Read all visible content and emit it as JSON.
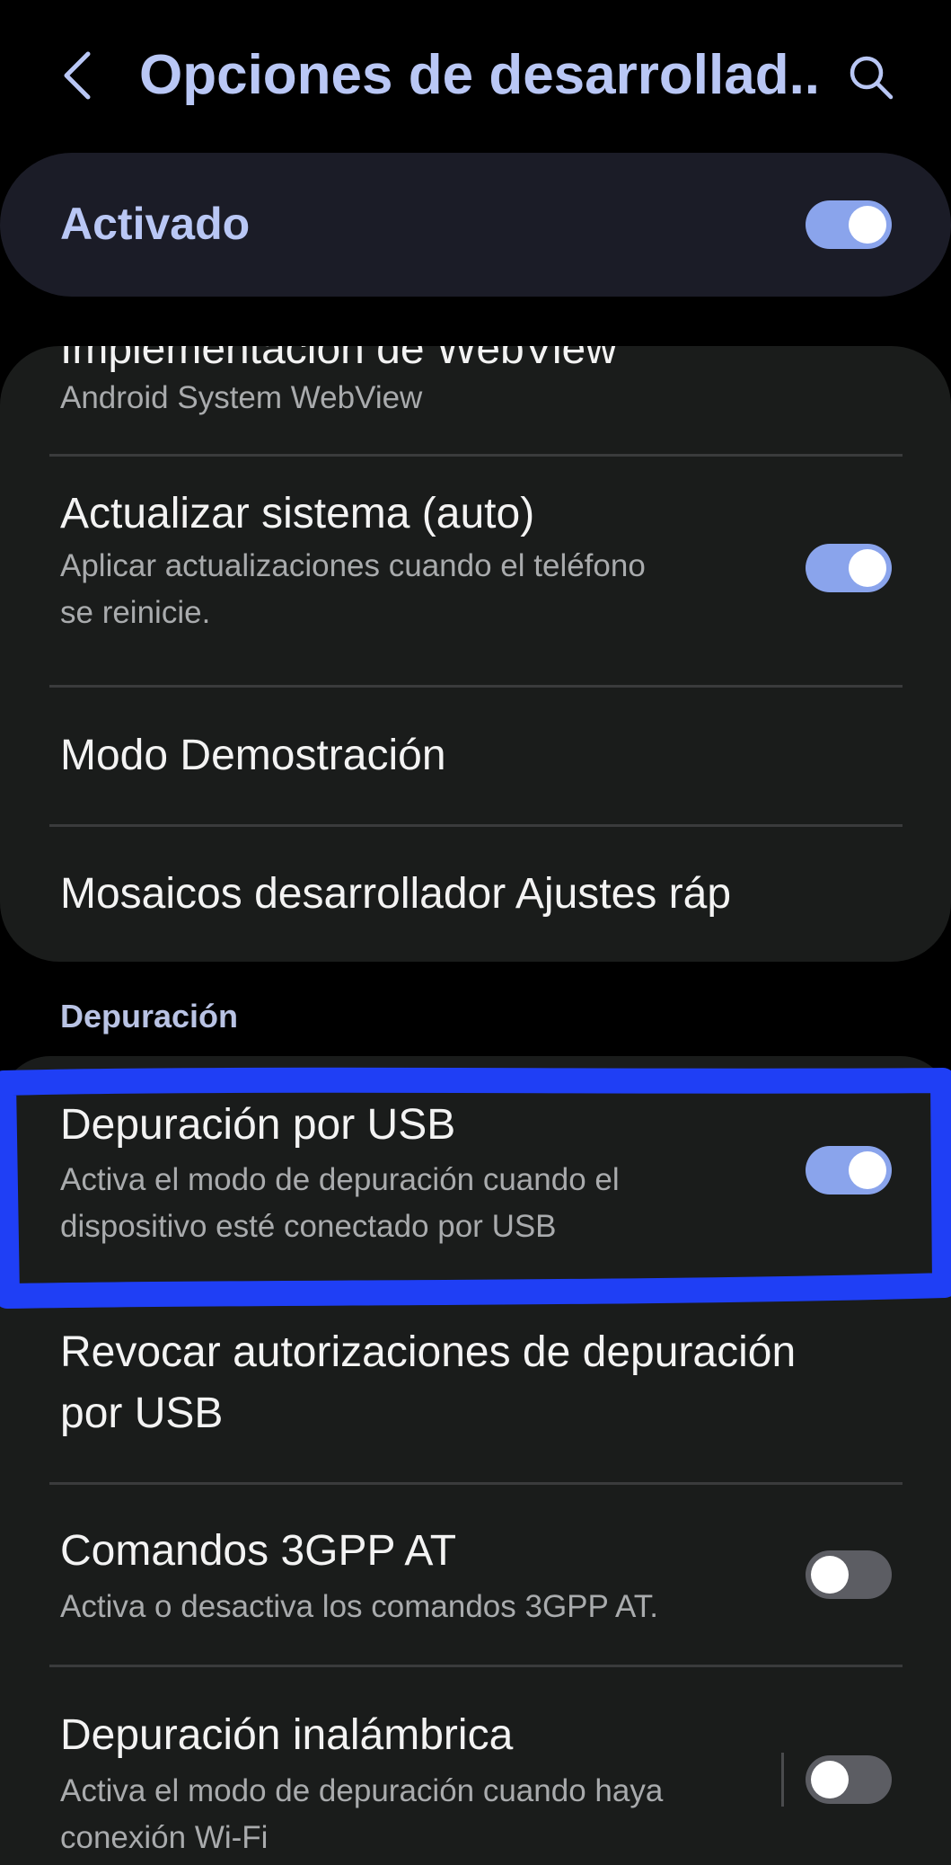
{
  "header": {
    "back_icon": "chevron-left-icon",
    "title": "Opciones de desarrollad...",
    "search_icon": "search-icon"
  },
  "master": {
    "label": "Activado",
    "enabled": true
  },
  "colors": {
    "background": "#000000",
    "card": "#1a1c1b",
    "accent": "#b9c7f5",
    "toggle_on": "#8aa4ec",
    "toggle_off": "#5c5d63",
    "annotation": "#1f3ff5"
  },
  "group1": {
    "webview": {
      "title": "Implementación de WebView",
      "subtitle": "Android System WebView"
    },
    "auto_update": {
      "title": "Actualizar sistema (auto)",
      "subtitle_line1": "Aplicar actualizaciones cuando el teléfono",
      "subtitle_line2": "se reinicie.",
      "enabled": true
    },
    "demo_mode": {
      "title": "Modo Demostración"
    },
    "quick_tiles": {
      "title": "Mosaicos desarrollador Ajustes ráp"
    }
  },
  "section": {
    "label": "Depuración"
  },
  "group2": {
    "usb_debugging": {
      "title": "Depuración por USB",
      "subtitle_line1": "Activa el modo de depuración cuando el",
      "subtitle_line2": "dispositivo esté conectado por USB",
      "enabled": true
    },
    "revoke": {
      "title_line1": "Revocar autorizaciones de depuración",
      "title_line2": "por USB"
    },
    "gpp_commands": {
      "title": "Comandos 3GPP AT",
      "subtitle": "Activa o desactiva los comandos 3GPP AT.",
      "enabled": false
    },
    "wireless_debugging": {
      "title": "Depuración inalámbrica",
      "subtitle_line1": "Activa el modo de depuración cuando haya",
      "subtitle_line2": "conexión Wi-Fi",
      "enabled": false
    }
  }
}
